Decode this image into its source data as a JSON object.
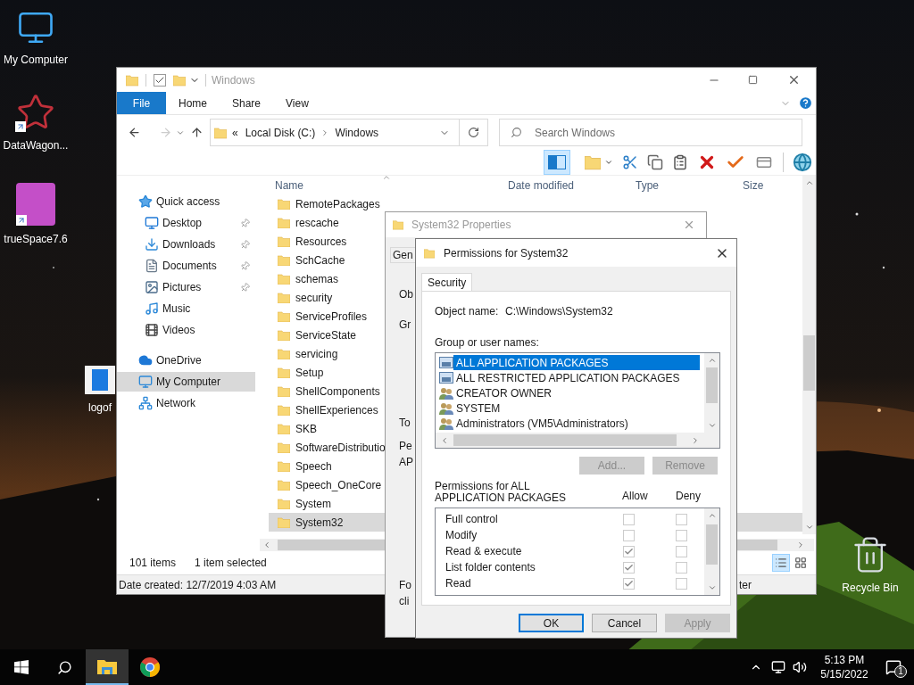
{
  "desktop_icons": [
    {
      "label": "My Computer",
      "kind": "computer",
      "shortcut": false
    },
    {
      "label": "DataWagon...",
      "kind": "star",
      "shortcut": true
    },
    {
      "label": "trueSpace7.6",
      "kind": "app",
      "shortcut": true
    },
    {
      "label": "logof",
      "kind": "document",
      "shortcut": false
    },
    {
      "label": "Recycle Bin",
      "kind": "recycle",
      "shortcut": false
    }
  ],
  "explorer": {
    "title": "Windows",
    "ribbon_tabs": [
      {
        "label": "File",
        "kind": "file"
      },
      {
        "label": "Home",
        "kind": "tab"
      },
      {
        "label": "Share",
        "kind": "tab"
      },
      {
        "label": "View",
        "kind": "tab"
      }
    ],
    "address": {
      "overflow": "«",
      "crumbs": [
        "Local Disk (C:)",
        "Windows"
      ]
    },
    "search": {
      "placeholder": "Search Windows"
    },
    "nav": [
      {
        "label": "Quick access",
        "kind": "quick",
        "selected": false,
        "children": [
          {
            "label": "Desktop",
            "kind": "desktop",
            "pinned": true,
            "selected": false
          },
          {
            "label": "Downloads",
            "kind": "downloads",
            "pinned": true,
            "selected": false
          },
          {
            "label": "Documents",
            "kind": "documents",
            "pinned": true,
            "selected": false
          },
          {
            "label": "Pictures",
            "kind": "pictures",
            "pinned": true,
            "selected": false
          },
          {
            "label": "Music",
            "kind": "music",
            "pinned": false,
            "selected": false
          },
          {
            "label": "Videos",
            "kind": "videos",
            "pinned": false,
            "selected": false
          }
        ]
      },
      {
        "label": "OneDrive",
        "kind": "cloud",
        "selected": false
      },
      {
        "label": "My Computer",
        "kind": "computer",
        "selected": true
      },
      {
        "label": "Network",
        "kind": "network",
        "selected": false
      }
    ],
    "columns": [
      "Name",
      "Date modified",
      "Type",
      "Size"
    ],
    "files": [
      {
        "name": "RemotePackages",
        "selected": false
      },
      {
        "name": "rescache",
        "selected": false
      },
      {
        "name": "Resources",
        "selected": false
      },
      {
        "name": "SchCache",
        "selected": false
      },
      {
        "name": "schemas",
        "selected": false
      },
      {
        "name": "security",
        "selected": false
      },
      {
        "name": "ServiceProfiles",
        "selected": false
      },
      {
        "name": "ServiceState",
        "selected": false
      },
      {
        "name": "servicing",
        "selected": false
      },
      {
        "name": "Setup",
        "selected": false
      },
      {
        "name": "ShellComponents",
        "selected": false
      },
      {
        "name": "ShellExperiences",
        "selected": false
      },
      {
        "name": "SKB",
        "selected": false
      },
      {
        "name": "SoftwareDistributio",
        "selected": false
      },
      {
        "name": "Speech",
        "selected": false
      },
      {
        "name": "Speech_OneCore",
        "selected": false
      },
      {
        "name": "System",
        "selected": false
      },
      {
        "name": "System32",
        "selected": true
      }
    ],
    "status": {
      "count": "101 items",
      "selection": "1 item selected"
    },
    "view_modes": [
      {
        "kind": "details",
        "selected": true
      },
      {
        "kind": "large-icons",
        "selected": false
      }
    ],
    "details": {
      "created": "Date created: 12/7/2019 4:03 AM",
      "right": "ter"
    }
  },
  "properties_dialog": {
    "title": "System32 Properties",
    "tab": "Gen",
    "labels": [
      "Ob",
      "Gr",
      "To",
      "Pe",
      "AP",
      "Fo",
      "cli"
    ]
  },
  "permissions_dialog": {
    "title": "Permissions for System32",
    "tabs": [
      {
        "label": "Security",
        "selected": true
      }
    ],
    "object_label": "Object name:",
    "object_value": "C:\\Windows\\System32",
    "group_label": "Group or user names:",
    "users": [
      {
        "name": "ALL APPLICATION PACKAGES",
        "kind": "package",
        "selected": true
      },
      {
        "name": "ALL RESTRICTED APPLICATION PACKAGES",
        "kind": "package",
        "selected": false
      },
      {
        "name": "CREATOR OWNER",
        "kind": "group",
        "selected": false
      },
      {
        "name": "SYSTEM",
        "kind": "group",
        "selected": false
      },
      {
        "name": "Administrators (VM5\\Administrators)",
        "kind": "group",
        "selected": false
      }
    ],
    "user_buttons": [
      {
        "label": "Add...",
        "disabled": true
      },
      {
        "label": "Remove",
        "disabled": true
      }
    ],
    "perm_label": "Permissions for ALL APPLICATION PACKAGES",
    "perm_columns": [
      "Allow",
      "Deny"
    ],
    "perms": [
      {
        "name": "Full control",
        "allow": false,
        "deny": false,
        "disabled": true
      },
      {
        "name": "Modify",
        "allow": false,
        "deny": false,
        "disabled": true
      },
      {
        "name": "Read & execute",
        "allow": true,
        "deny": false,
        "disabled": true
      },
      {
        "name": "List folder contents",
        "allow": true,
        "deny": false,
        "disabled": true
      },
      {
        "name": "Read",
        "allow": true,
        "deny": false,
        "disabled": true
      }
    ],
    "buttons": [
      {
        "label": "OK",
        "default": true,
        "disabled": false
      },
      {
        "label": "Cancel",
        "default": false,
        "disabled": false
      },
      {
        "label": "Apply",
        "default": false,
        "disabled": true
      }
    ]
  },
  "taskbar": {
    "apps": [
      {
        "kind": "start",
        "active": false
      },
      {
        "kind": "search",
        "active": false
      },
      {
        "kind": "explorer",
        "active": true
      },
      {
        "kind": "chrome",
        "active": false
      }
    ],
    "tray": {
      "time": "5:13 PM",
      "date": "5/15/2022",
      "notifications": "1"
    }
  }
}
